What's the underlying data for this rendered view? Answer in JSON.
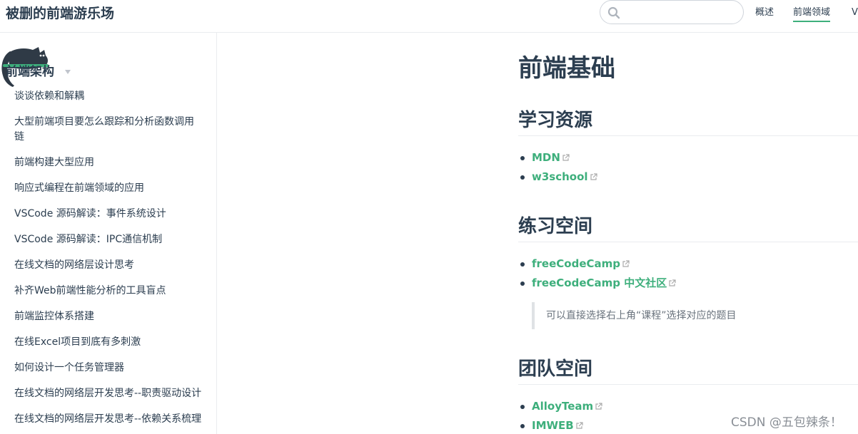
{
  "header": {
    "site_title": "被删的前端游乐场",
    "search": {
      "value": "",
      "placeholder": ""
    },
    "nav": [
      {
        "label": "概述",
        "active": false
      },
      {
        "label": "前端领域",
        "active": true
      },
      {
        "label": "V",
        "active": false
      }
    ]
  },
  "sidebar": {
    "section_title": "前端架构",
    "items": [
      {
        "label": "谈谈依赖和解耦"
      },
      {
        "label": "大型前端项目要怎么跟踪和分析函数调用链"
      },
      {
        "label": "前端构建大型应用"
      },
      {
        "label": "响应式编程在前端领域的应用"
      },
      {
        "label": "VSCode 源码解读：事件系统设计"
      },
      {
        "label": "VSCode 源码解读：IPC通信机制"
      },
      {
        "label": "在线文档的网络层设计思考"
      },
      {
        "label": "补齐Web前端性能分析的工具盲点"
      },
      {
        "label": "前端监控体系搭建"
      },
      {
        "label": "在线Excel项目到底有多刺激"
      },
      {
        "label": "如何设计一个任务管理器"
      },
      {
        "label": "在线文档的网络层开发思考--职责驱动设计"
      },
      {
        "label": "在线文档的网络层开发思考--依赖关系梳理"
      }
    ]
  },
  "main": {
    "title": "前端基础",
    "sections": [
      {
        "heading": "学习资源",
        "links": [
          {
            "label": "MDN"
          },
          {
            "label": "w3school"
          }
        ]
      },
      {
        "heading": "练习空间",
        "links": [
          {
            "label": "freeCodeCamp"
          },
          {
            "label": "freeCodeCamp 中文社区"
          }
        ],
        "tip": "可以直接选择右上角“课程”选择对应的题目"
      },
      {
        "heading": "团队空间",
        "links": [
          {
            "label": "AlloyTeam"
          },
          {
            "label": "IMWEB"
          }
        ]
      }
    ]
  },
  "watermark": "CSDN @五包辣条！",
  "colors": {
    "accent": "#3eaf7c",
    "text": "#2c3e50",
    "border": "#eaecef",
    "muted": "#6a737d"
  }
}
